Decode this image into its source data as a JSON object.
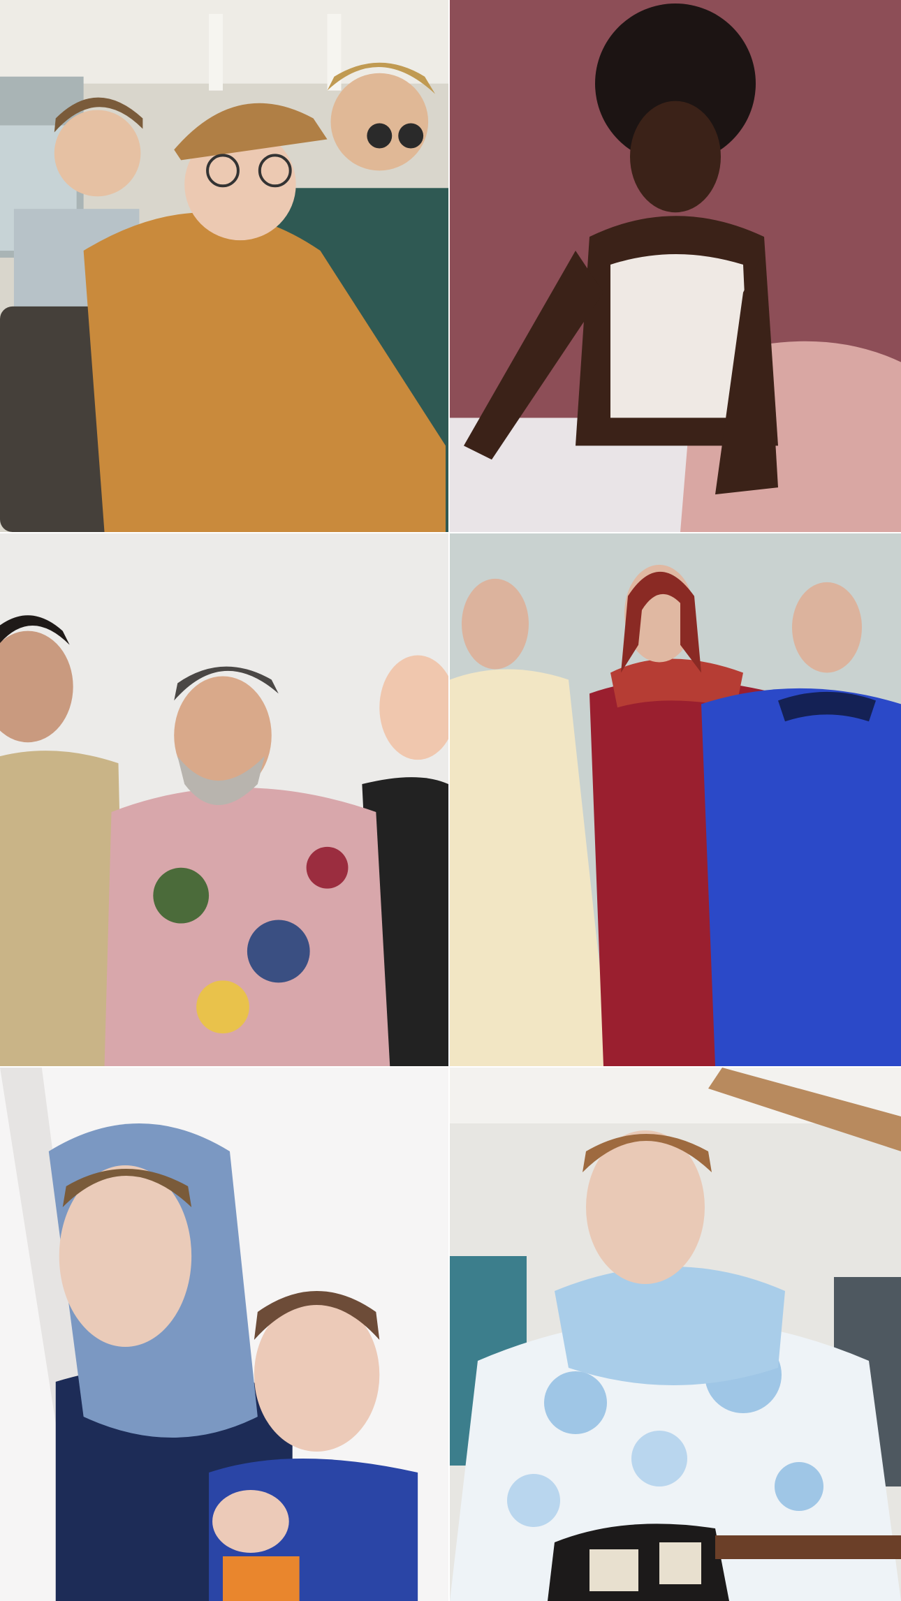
{
  "photos": [
    {
      "subject": "three-men-in-train",
      "palette": {
        "bg": "#d7d3c8",
        "accent": "#c98a3c"
      }
    },
    {
      "subject": "woman-on-bed",
      "palette": {
        "bg": "#8d4e57",
        "accent": "#efe9e4"
      }
    },
    {
      "subject": "three-men-laughing",
      "palette": {
        "bg": "#ecebe9",
        "accent": "#c9b487"
      }
    },
    {
      "subject": "three-figures-in-robes",
      "palette": {
        "bg": "#c9d2d0",
        "accent": "#2b49c8"
      }
    },
    {
      "subject": "two-people-headscarf",
      "palette": {
        "bg": "#f2f1f0",
        "accent": "#1d2c57"
      }
    },
    {
      "subject": "man-with-guitar",
      "palette": {
        "bg": "#e7e6e2",
        "accent": "#9fc6e6"
      }
    }
  ]
}
